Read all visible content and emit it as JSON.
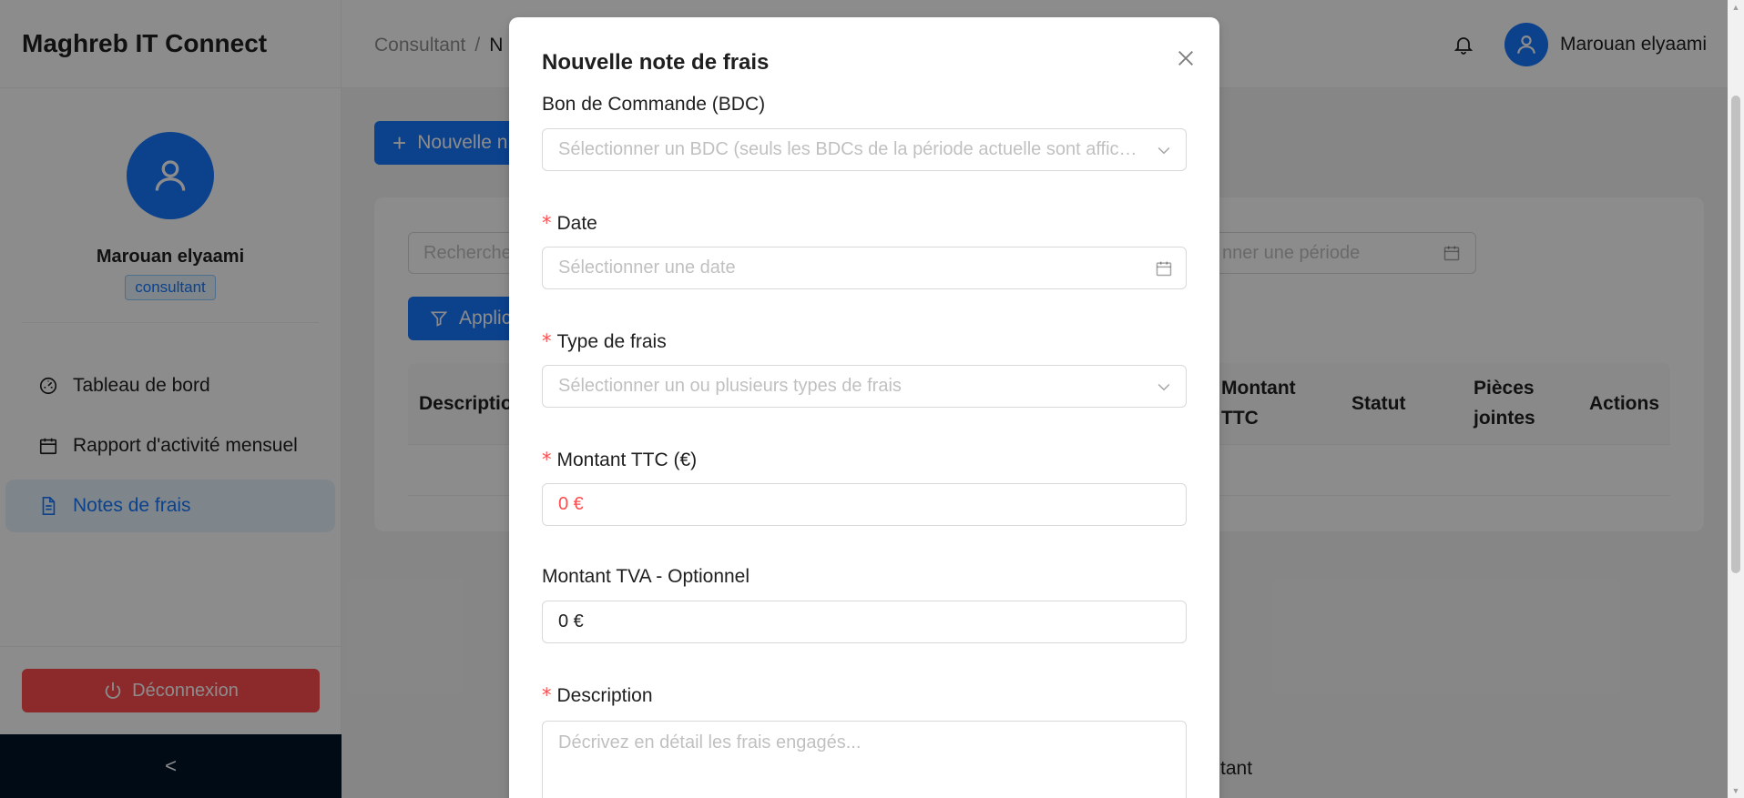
{
  "app": {
    "name": "Maghreb IT Connect"
  },
  "header": {
    "breadcrumb": [
      "Consultant",
      "N"
    ],
    "user_name": "Marouan elyaami"
  },
  "sidebar": {
    "profile_name": "Marouan elyaami",
    "role": "consultant",
    "items": [
      {
        "label": "Tableau de bord",
        "icon": "dashboard-icon"
      },
      {
        "label": "Rapport d'activité mensuel",
        "icon": "calendar-icon"
      },
      {
        "label": "Notes de frais",
        "icon": "file-icon",
        "active": true
      }
    ],
    "logout_label": "Déconnexion",
    "collapse_symbol": "<"
  },
  "content": {
    "new_button_label": "Nouvelle n",
    "search_placeholder": "Recherche",
    "period_placeholder": "nner une période",
    "apply_label": "Applic",
    "columns": [
      "Descriptio",
      "Montant TTC",
      "Statut",
      "Pièces jointes",
      "Actions"
    ],
    "bottom_partial_text": "tant"
  },
  "modal": {
    "title": "Nouvelle note de frais",
    "fields": {
      "bdc": {
        "label": "Bon de Commande (BDC)",
        "placeholder": "Sélectionner un BDC (seuls les BDCs de la période actuelle sont affichés)",
        "required": false
      },
      "date": {
        "label": "Date",
        "placeholder": "Sélectionner une date",
        "required": true
      },
      "type": {
        "label": "Type de frais",
        "placeholder": "Sélectionner un ou plusieurs types de frais",
        "required": true
      },
      "ttc": {
        "label": "Montant TTC (€)",
        "value": "0 €",
        "required": true
      },
      "tva": {
        "label": "Montant TVA - Optionnel",
        "value": "0 €",
        "required": false
      },
      "description": {
        "label": "Description",
        "placeholder": "Décrivez en détail les frais engagés...",
        "required": true
      }
    },
    "required_mark": "*"
  },
  "colors": {
    "primary": "#1677ff",
    "danger": "#ff4d4f",
    "sider_trigger": "#001529"
  }
}
